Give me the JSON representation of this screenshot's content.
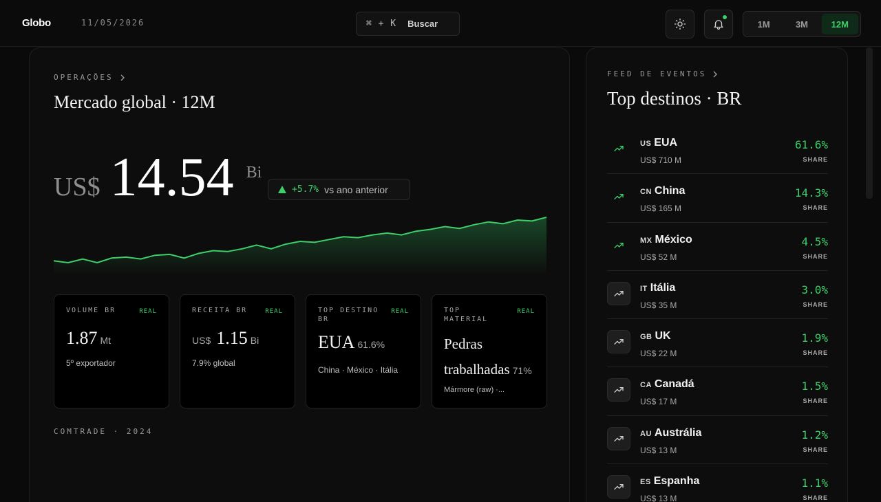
{
  "header": {
    "brand": "Globo",
    "date": "11/05/2026",
    "search_shortcut": "⌘ + K",
    "search_label": "Buscar",
    "ranges": [
      {
        "label": "1M",
        "active": false
      },
      {
        "label": "3M",
        "active": false
      },
      {
        "label": "12M",
        "active": true
      }
    ]
  },
  "main": {
    "eyebrow": "OPERAÇÕES",
    "title": "Mercado global · 12M",
    "currency": "US$",
    "value": "14.54",
    "unit": "Bi",
    "delta_pct": "+5.7%",
    "delta_text": "vs ano anterior",
    "cards": [
      {
        "label": "VOLUME BR",
        "tag": "REAL",
        "prefix": "",
        "value": "1.87",
        "suffix": "Mt",
        "sub": "5º exportador"
      },
      {
        "label": "RECEITA BR",
        "tag": "REAL",
        "prefix": "US$",
        "value": "1.15",
        "suffix": "Bi",
        "sub": "7.9% global"
      },
      {
        "label": "TOP DESTINO BR",
        "tag": "REAL",
        "prefix": "",
        "value": "EUA",
        "suffix": "61.6%",
        "sub": "China · México · Itália"
      },
      {
        "label": "TOP MATERIAL",
        "tag": "REAL",
        "prefix": "",
        "value": "Pedras trabalhadas",
        "suffix": "71%",
        "sub": "Mármore (raw) ·..."
      }
    ],
    "footer_label": "COMTRADE · 2024"
  },
  "chart_data": {
    "type": "area",
    "x": [
      1,
      2,
      3,
      4,
      5,
      6,
      7,
      8,
      9,
      10,
      11,
      12,
      13,
      14,
      15,
      16,
      17,
      18,
      19,
      20,
      21,
      22,
      23,
      24,
      25,
      26,
      27,
      28,
      29,
      30,
      31,
      32,
      33,
      34,
      35
    ],
    "values": [
      3,
      1,
      5,
      1,
      6,
      7,
      5,
      9,
      10,
      6,
      11,
      14,
      13,
      16,
      20,
      16,
      21,
      24,
      23,
      26,
      29,
      28,
      31,
      33,
      31,
      35,
      37,
      40,
      38,
      42,
      45,
      43,
      47,
      46,
      50
    ]
  },
  "feed": {
    "eyebrow": "FEED DE EVENTOS",
    "title": "Top destinos · BR",
    "items": [
      {
        "code": "US",
        "name": "EUA",
        "value": "US$ 710 M",
        "pct": "61.6%",
        "share": "SHARE",
        "top": true
      },
      {
        "code": "CN",
        "name": "China",
        "value": "US$ 165 M",
        "pct": "14.3%",
        "share": "SHARE",
        "top": true
      },
      {
        "code": "MX",
        "name": "México",
        "value": "US$ 52 M",
        "pct": "4.5%",
        "share": "SHARE",
        "top": true
      },
      {
        "code": "IT",
        "name": "Itália",
        "value": "US$ 35 M",
        "pct": "3.0%",
        "share": "SHARE",
        "top": false
      },
      {
        "code": "GB",
        "name": "UK",
        "value": "US$ 22 M",
        "pct": "1.9%",
        "share": "SHARE",
        "top": false
      },
      {
        "code": "CA",
        "name": "Canadá",
        "value": "US$ 17 M",
        "pct": "1.5%",
        "share": "SHARE",
        "top": false
      },
      {
        "code": "AU",
        "name": "Austrália",
        "value": "US$ 13 M",
        "pct": "1.2%",
        "share": "SHARE",
        "top": false
      },
      {
        "code": "ES",
        "name": "Espanha",
        "value": "US$ 13 M",
        "pct": "1.1%",
        "share": "SHARE",
        "top": false
      }
    ]
  },
  "colors": {
    "accent": "#3ecf6a",
    "background": "#0a0a0a"
  }
}
